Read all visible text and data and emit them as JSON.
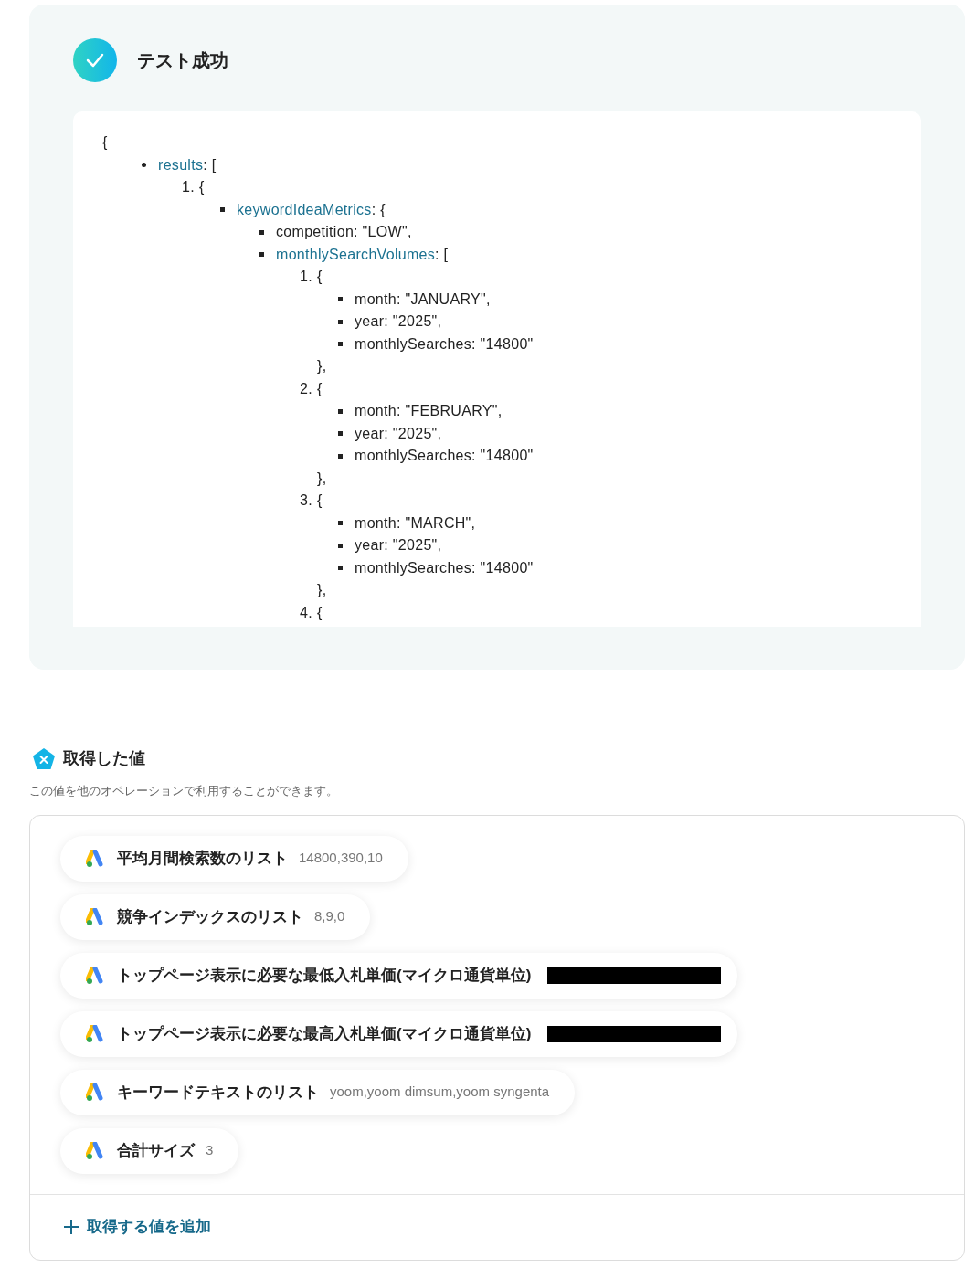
{
  "test_result": {
    "title": "テスト成功",
    "success": true
  },
  "json_tree": {
    "text": "{",
    "children": [
      {
        "kind": "disc",
        "key": "results",
        "text": ": [",
        "children": [
          {
            "kind": "number",
            "number": "1.",
            "text": "{",
            "children": [
              {
                "kind": "square",
                "key": "keywordIdeaMetrics",
                "text": ": {",
                "children": [
                  {
                    "kind": "square",
                    "text": "competition: \"LOW\","
                  },
                  {
                    "kind": "square",
                    "key": "monthlySearchVolumes",
                    "text": ": [",
                    "children": [
                      {
                        "kind": "number",
                        "number": "1.",
                        "text": "{",
                        "children": [
                          {
                            "kind": "square",
                            "text": "month: \"JANUARY\","
                          },
                          {
                            "kind": "square",
                            "text": "year: \"2025\","
                          },
                          {
                            "kind": "square",
                            "text": "monthlySearches: \"14800\""
                          }
                        ]
                      },
                      {
                        "kind": "plain",
                        "text": "},"
                      },
                      {
                        "kind": "number",
                        "number": "2.",
                        "text": "{",
                        "children": [
                          {
                            "kind": "square",
                            "text": "month: \"FEBRUARY\","
                          },
                          {
                            "kind": "square",
                            "text": "year: \"2025\","
                          },
                          {
                            "kind": "square",
                            "text": "monthlySearches: \"14800\""
                          }
                        ]
                      },
                      {
                        "kind": "plain",
                        "text": "},"
                      },
                      {
                        "kind": "number",
                        "number": "3.",
                        "text": "{",
                        "children": [
                          {
                            "kind": "square",
                            "text": "month: \"MARCH\","
                          },
                          {
                            "kind": "square",
                            "text": "year: \"2025\","
                          },
                          {
                            "kind": "square",
                            "text": "monthlySearches: \"14800\""
                          }
                        ]
                      },
                      {
                        "kind": "plain",
                        "text": "},"
                      },
                      {
                        "kind": "number",
                        "number": "4.",
                        "text": "{"
                      }
                    ]
                  }
                ]
              }
            ]
          }
        ]
      }
    ]
  },
  "values_section": {
    "title": "取得した値",
    "description": "この値を他のオペレーションで利用することができます。",
    "items": [
      {
        "label": "平均月間検索数のリスト",
        "value": "14800,390,10",
        "redacted": false
      },
      {
        "label": "競争インデックスのリスト",
        "value": "8,9,0",
        "redacted": false
      },
      {
        "label": "トップページ表示に必要な最低入札単価(マイクロ通貨単位)",
        "redacted": true
      },
      {
        "label": "トップページ表示に必要な最高入札単価(マイクロ通貨単位)",
        "redacted": true
      },
      {
        "label": "キーワードテキストのリスト",
        "value": "yoom,yoom dimsum,yoom syngenta",
        "redacted": false
      },
      {
        "label": "合計サイズ",
        "value": "3",
        "redacted": false
      }
    ],
    "add_button": {
      "label": "取得する値を追加"
    }
  }
}
